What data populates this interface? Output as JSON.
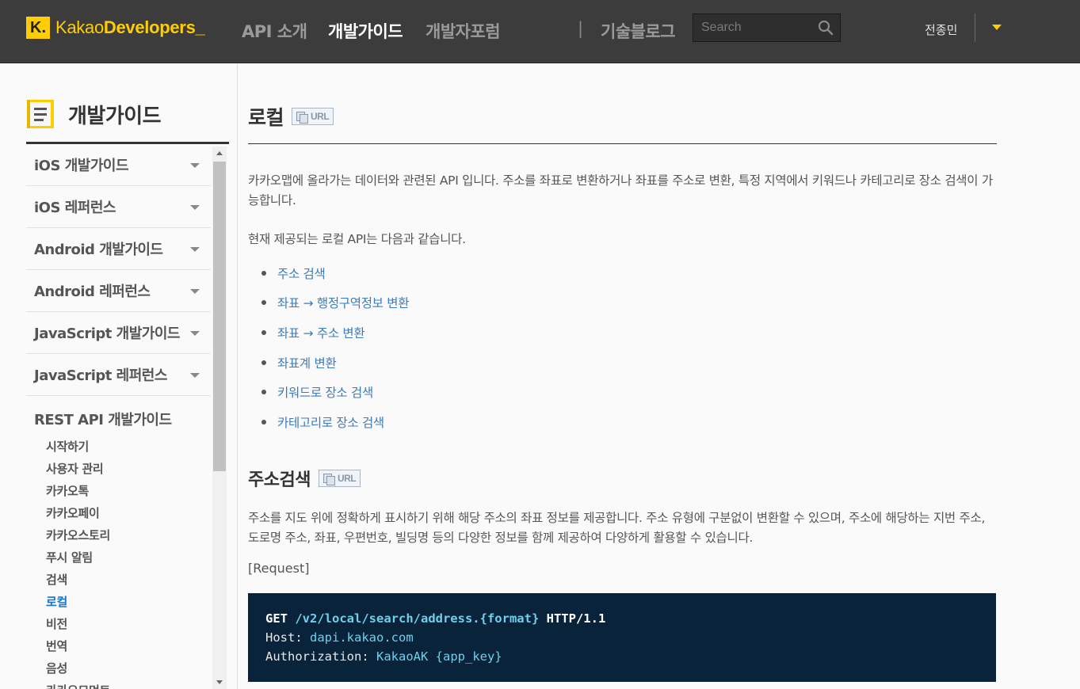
{
  "header": {
    "logo_k": "K.",
    "logo_prefix": "Kakao",
    "logo_bold": "Developers_",
    "nav": [
      {
        "label": "API 소개"
      },
      {
        "label": "개발가이드"
      },
      {
        "label": "개발자포럼"
      },
      {
        "label": "기술블로그"
      }
    ],
    "nav_sep": "|",
    "search_placeholder": "Search",
    "user_name": "전종민",
    "colors": {
      "accent": "#ffcd00",
      "bar": "#3c3c3c"
    }
  },
  "sidebar": {
    "title": "개발가이드",
    "items": [
      {
        "label": "iOS 개발가이드"
      },
      {
        "label": "iOS 레퍼런스"
      },
      {
        "label": "Android 개발가이드"
      },
      {
        "label": "Android 레퍼런스"
      },
      {
        "label": "JavaScript 개발가이드"
      },
      {
        "label": "JavaScript 레퍼런스"
      }
    ],
    "section": "REST API 개발가이드",
    "sub_items": [
      {
        "label": "시작하기"
      },
      {
        "label": "사용자 관리"
      },
      {
        "label": "카카오톡"
      },
      {
        "label": "카카오페이"
      },
      {
        "label": "카카오스토리"
      },
      {
        "label": "푸시 알림"
      },
      {
        "label": "검색"
      },
      {
        "label": "로컬"
      },
      {
        "label": "비전"
      },
      {
        "label": "번역"
      },
      {
        "label": "음성"
      },
      {
        "label": "카카오모먼트"
      }
    ],
    "active_sub": "로컬"
  },
  "main": {
    "title": "로컬",
    "url_badge": "URL",
    "intro": "카카오맵에 올라가는 데이터와 관련된 API 입니다. 주소를 좌표로 변환하거나 좌표를 주소로 변환, 특정 지역에서 키워드나 카테고리로 장소 검색이 가능합니다.",
    "list_intro": "현재 제공되는 로컬 API는 다음과 같습니다.",
    "links": [
      {
        "label": "주소 검색"
      },
      {
        "label": "좌표 → 행정구역정보 변환"
      },
      {
        "label": "좌표 → 주소 변환"
      },
      {
        "label": "좌표계 변환"
      },
      {
        "label": "키워드로 장소 검색"
      },
      {
        "label": "카테고리로 장소 검색"
      }
    ],
    "section_title": "주소검색",
    "section_desc": "주소를 지도 위에 정확하게 표시하기 위해 해당 주소의 좌표 정보를 제공합니다. 주소 유형에 구분없이 변환할 수 있으며, 주소에 해당하는 지번 주소, 도로명 주소, 좌표, 우편번호, 빌딩명 등의 다양한 정보를 함께 제공하여 다양하게 활용할 수 있습니다.",
    "request_label": "[Request]",
    "code": {
      "method": "GET",
      "path": "/v2/local/search/address.{format}",
      "protocol": "HTTP/1.1",
      "host_key": "Host:",
      "host_val": "dapi.kakao.com",
      "auth_key": "Authorization:",
      "auth_val": "KakaoAK {app_key}"
    }
  }
}
